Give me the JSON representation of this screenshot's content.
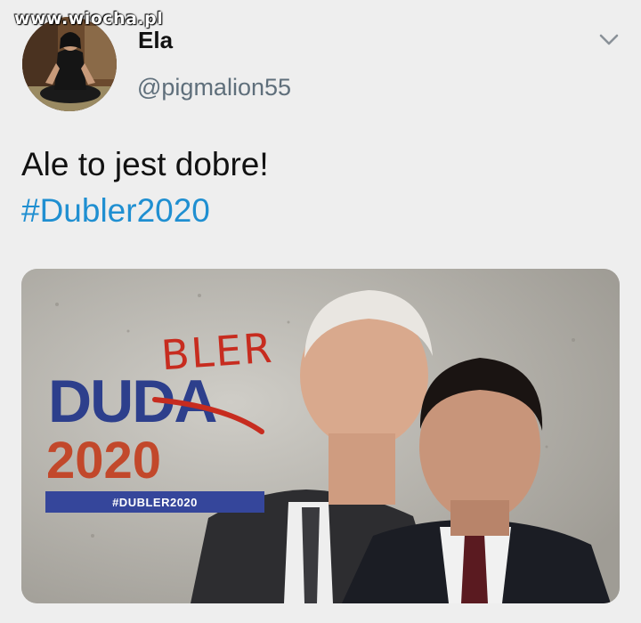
{
  "watermark": "www.wiocha.pl",
  "user": {
    "name": "Ela",
    "handle": "@pigmalion55",
    "avatar_icon": "avatar"
  },
  "menu_icon": "chevron-down-icon",
  "tweet": {
    "text": "Ale to jest dobre!",
    "hashtag": "#Dubler2020"
  },
  "poster": {
    "name_word": "DUDA",
    "overwrite": "BLER",
    "year": "2020",
    "bar_hashtag": "#DUBLER2020"
  },
  "colors": {
    "background": "#eeeeee",
    "hashtag": "#1f8fd1",
    "poster_blue": "#2d3f8c",
    "poster_red": "#c2482b"
  }
}
